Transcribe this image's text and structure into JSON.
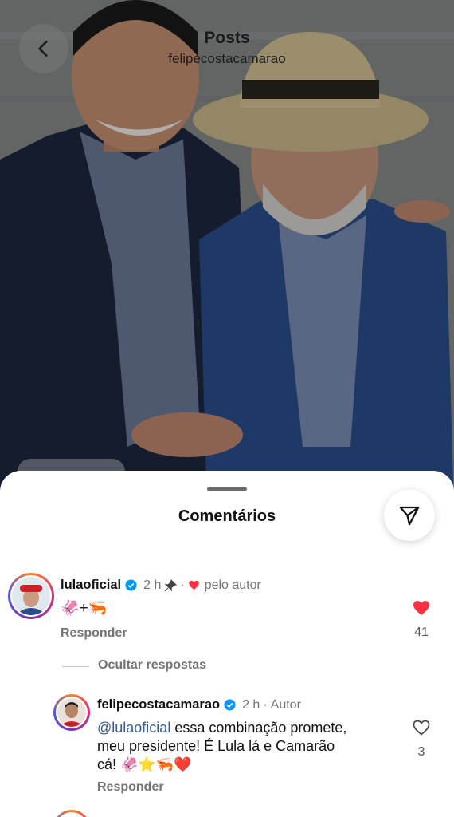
{
  "header": {
    "title": "Posts",
    "subtitle": "felipecostacamarao"
  },
  "sheet": {
    "title": "Comentários"
  },
  "comments": [
    {
      "username": "lulaoficial",
      "time": "2 h",
      "separator": "·",
      "liked_by_author": "pelo autor",
      "text": "🦑+🦐",
      "reply_label": "Responder",
      "likes": "41",
      "liked": true
    }
  ],
  "hide_replies_label": "Ocultar respostas",
  "replies": [
    {
      "username": "felipecostacamarao",
      "time": "2 h",
      "separator": "·",
      "author_tag": "Autor",
      "mention": "@lulaoficial",
      "text_line1_rest": " essa combinação promete,",
      "text_line2": "meu presidente! É Lula lá e Camarão",
      "text_line3": "cá! 🦑⭐🦐❤️",
      "reply_label": "Responder",
      "likes": "3",
      "liked": false
    }
  ],
  "colors": {
    "like_red": "#ff3040",
    "verified_blue": "#0095f6",
    "mention_blue": "#375a96",
    "muted_gray": "#737373"
  },
  "icons": [
    "back-chevron-icon",
    "send-icon",
    "verified-icon",
    "pin-icon",
    "heart-icon"
  ]
}
